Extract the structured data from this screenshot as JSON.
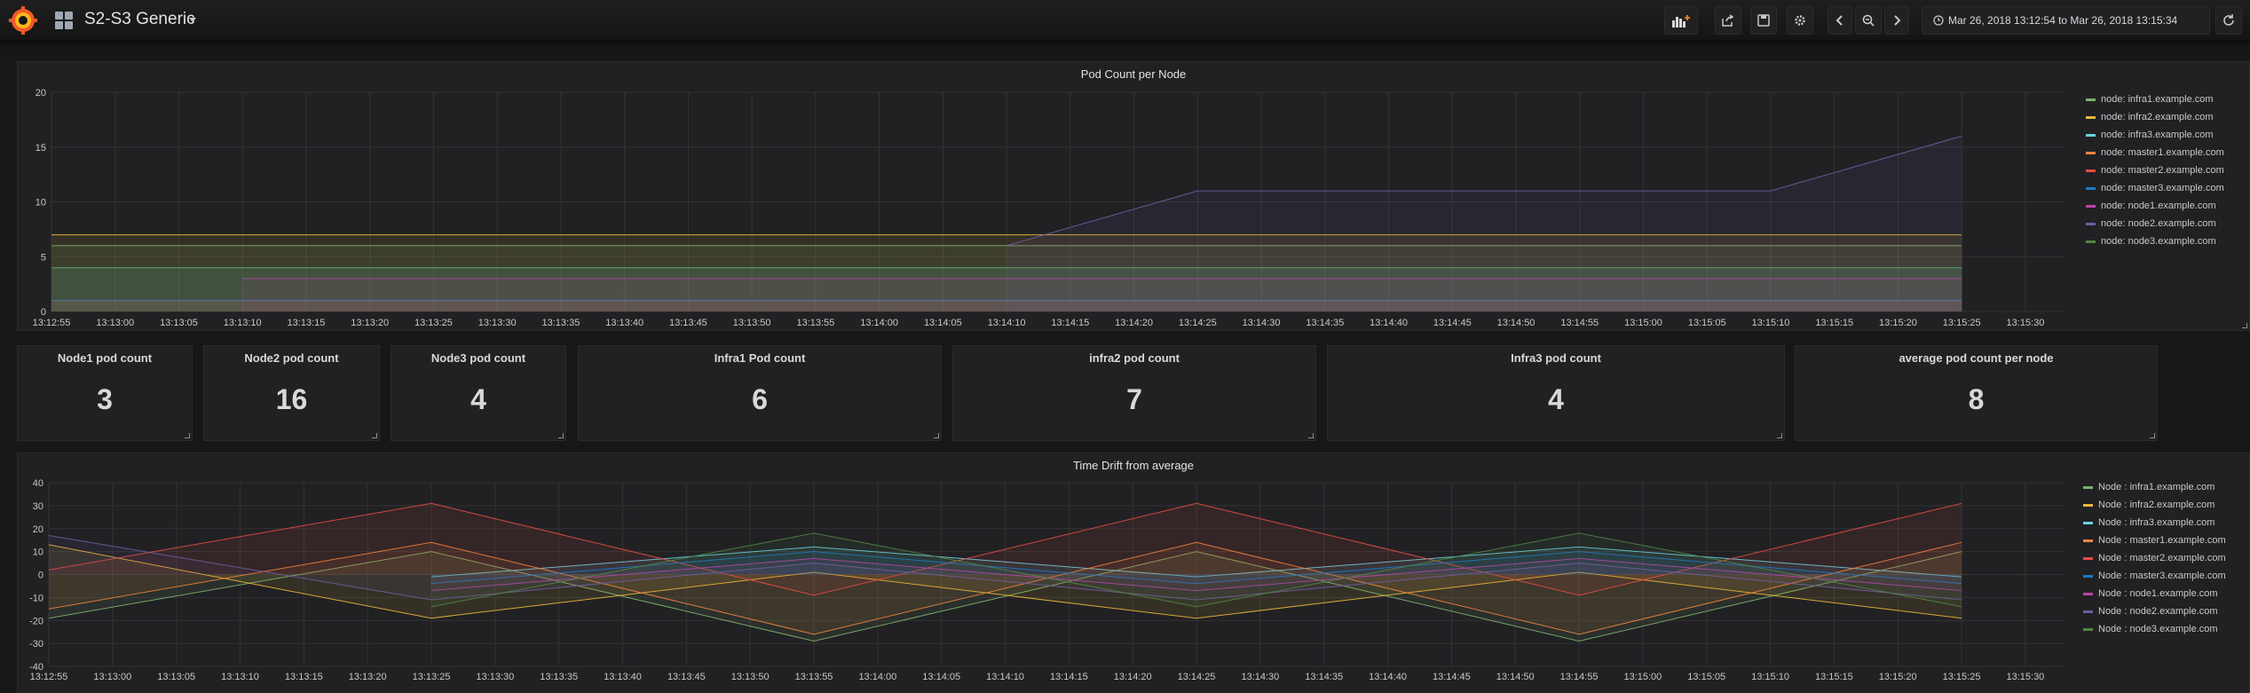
{
  "navbar": {
    "dashboard_title": "S2-S3 Generic",
    "time_range": "Mar 26, 2018 13:12:54 to Mar 26, 2018 13:15:34",
    "buttons": [
      "add-panel-icon",
      "share-icon",
      "save-icon",
      "gear-icon",
      "chevron-left-icon",
      "zoom-out-icon",
      "chevron-right-icon",
      "refresh-icon"
    ]
  },
  "stats": [
    {
      "title": "Node1 pod count",
      "value": "3"
    },
    {
      "title": "Node2 pod count",
      "value": "16"
    },
    {
      "title": "Node3 pod count",
      "value": "4"
    },
    {
      "title": "Infra1 Pod count",
      "value": "6"
    },
    {
      "title": "infra2 pod count",
      "value": "7"
    },
    {
      "title": "Infra3 pod count",
      "value": "4"
    },
    {
      "title": "average pod count per node",
      "value": "8"
    }
  ],
  "chart_data": [
    {
      "type": "area",
      "title": "Pod Count per Node",
      "ylim": [
        0,
        20
      ],
      "yticks": [
        "0",
        "5",
        "10",
        "15",
        "20"
      ],
      "xticks": [
        "13:12:55",
        "13:13:00",
        "13:13:05",
        "13:13:10",
        "13:13:15",
        "13:13:20",
        "13:13:25",
        "13:13:30",
        "13:13:35",
        "13:13:40",
        "13:13:45",
        "13:13:50",
        "13:13:55",
        "13:14:00",
        "13:14:05",
        "13:14:10",
        "13:14:15",
        "13:14:20",
        "13:14:25",
        "13:14:30",
        "13:14:35",
        "13:14:40",
        "13:14:45",
        "13:14:50",
        "13:14:55",
        "13:15:00",
        "13:15:05",
        "13:15:10",
        "13:15:15",
        "13:15:20",
        "13:15:25",
        "13:15:30"
      ],
      "x": [
        "13:12:55",
        "13:13:10",
        "13:14:10",
        "13:14:25",
        "13:15:10",
        "13:15:25"
      ],
      "grid": true,
      "legend_position": "right",
      "series": [
        {
          "name": "node: infra1.example.com",
          "color": "#7eb26d",
          "values": [
            6,
            6,
            6,
            6,
            6,
            6
          ]
        },
        {
          "name": "node: infra2.example.com",
          "color": "#eab839",
          "values": [
            7,
            7,
            7,
            7,
            7,
            7
          ]
        },
        {
          "name": "node: infra3.example.com",
          "color": "#6ed0e0",
          "values": [
            4,
            4,
            4,
            4,
            4,
            4
          ]
        },
        {
          "name": "node: master1.example.com",
          "color": "#ef843c",
          "values": [
            1,
            1,
            1,
            1,
            1,
            1
          ]
        },
        {
          "name": "node: master2.example.com",
          "color": "#e24d42",
          "values": [
            1,
            1,
            1,
            1,
            1,
            1
          ]
        },
        {
          "name": "node: master3.example.com",
          "color": "#1f78c1",
          "values": [
            1,
            1,
            1,
            1,
            1,
            1
          ]
        },
        {
          "name": "node: node1.example.com",
          "color": "#ba43a9",
          "values": [
            null,
            3,
            3,
            3,
            3,
            3
          ]
        },
        {
          "name": "node: node2.example.com",
          "color": "#705da0",
          "values": [
            null,
            null,
            6,
            11,
            11,
            16
          ]
        },
        {
          "name": "node: node3.example.com",
          "color": "#508642",
          "values": [
            4,
            4,
            4,
            4,
            4,
            4
          ]
        }
      ]
    },
    {
      "type": "area",
      "title": "Time Drift from average",
      "ylim": [
        -40,
        40
      ],
      "yticks": [
        "-40",
        "-30",
        "-20",
        "-10",
        "0",
        "10",
        "20",
        "30",
        "40"
      ],
      "xticks": [
        "13:12:55",
        "13:13:00",
        "13:13:05",
        "13:13:10",
        "13:13:15",
        "13:13:20",
        "13:13:25",
        "13:13:30",
        "13:13:35",
        "13:13:40",
        "13:13:45",
        "13:13:50",
        "13:13:55",
        "13:14:00",
        "13:14:05",
        "13:14:10",
        "13:14:15",
        "13:14:20",
        "13:14:25",
        "13:14:30",
        "13:14:35",
        "13:14:40",
        "13:14:45",
        "13:14:50",
        "13:14:55",
        "13:15:00",
        "13:15:05",
        "13:15:10",
        "13:15:15",
        "13:15:20",
        "13:15:25",
        "13:15:30"
      ],
      "x": [
        "13:12:55",
        "13:13:25",
        "13:13:55",
        "13:14:25",
        "13:14:55",
        "13:15:25"
      ],
      "grid": true,
      "legend_position": "right",
      "series": [
        {
          "name": "Node : infra1.example.com",
          "color": "#7eb26d",
          "values": [
            -19,
            10,
            -29,
            10,
            -29,
            10
          ]
        },
        {
          "name": "Node : infra2.example.com",
          "color": "#eab839",
          "values": [
            13,
            -19,
            1,
            -19,
            1,
            -19
          ]
        },
        {
          "name": "Node : infra3.example.com",
          "color": "#6ed0e0",
          "values": [
            null,
            -1,
            12,
            -1,
            12,
            -1
          ]
        },
        {
          "name": "Node : master1.example.com",
          "color": "#ef843c",
          "values": [
            -15,
            14,
            -26,
            14,
            -26,
            14
          ]
        },
        {
          "name": "Node : master2.example.com",
          "color": "#e24d42",
          "values": [
            2,
            31,
            -9,
            31,
            -9,
            31
          ]
        },
        {
          "name": "Node : master3.example.com",
          "color": "#1f78c1",
          "values": [
            null,
            -4,
            10,
            -4,
            10,
            -4
          ]
        },
        {
          "name": "Node : node1.example.com",
          "color": "#ba43a9",
          "values": [
            null,
            -7,
            7,
            -7,
            7,
            -7
          ]
        },
        {
          "name": "Node : node2.example.com",
          "color": "#705da0",
          "values": [
            17,
            -11,
            5,
            -11,
            5,
            -11
          ]
        },
        {
          "name": "Node : node3.example.com",
          "color": "#508642",
          "values": [
            null,
            -14,
            18,
            -14,
            18,
            -14
          ]
        }
      ]
    }
  ]
}
